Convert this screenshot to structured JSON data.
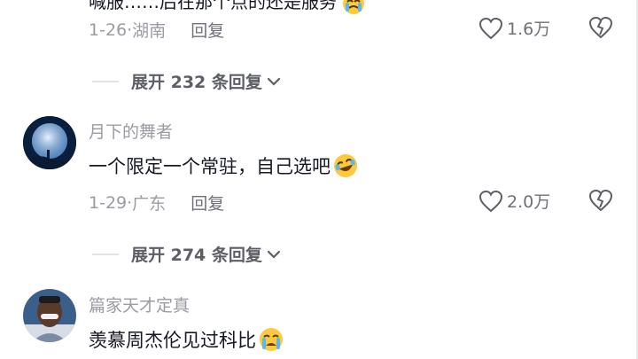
{
  "comment1": {
    "text_partial": "喊服……后在那个点的还是服务",
    "date": "1-26",
    "location": "湖南",
    "reply_label": "回复",
    "likes": "1.6万",
    "expand_label": "展开 232 条回复"
  },
  "comment2": {
    "username": "月下的舞者",
    "text": "一个限定一个常驻，自己选吧",
    "date": "1-29",
    "location": "广东",
    "reply_label": "回复",
    "likes": "2.0万",
    "expand_label": "展开 274 条回复"
  },
  "comment3": {
    "username": "篇家天才定真",
    "text": "羡慕周杰伦见过科比"
  },
  "colors": {
    "meta_gray": "#9b9ca3",
    "text_dark": "#161823",
    "emoji_yellow": "#ffc83d"
  },
  "icons": [
    "heart-icon",
    "broken-heart-icon",
    "chevron-down-icon",
    "laughing-emoji-icon",
    "crying-emoji-icon"
  ]
}
